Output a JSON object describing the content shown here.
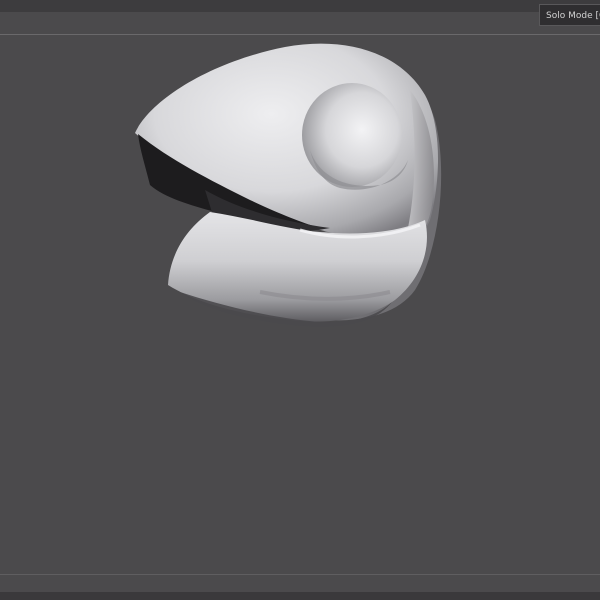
{
  "tooltip": {
    "text": "Solo Mode [Q"
  },
  "viewport": {
    "background_color": "#4b4a4c",
    "object": "sculpted-mesh"
  },
  "colors": {
    "mesh_light": "#e6e6e8",
    "mesh_mid": "#b5b5b8",
    "mesh_shadow": "#5a595c",
    "mouth_interior": "#1d1c1e"
  }
}
